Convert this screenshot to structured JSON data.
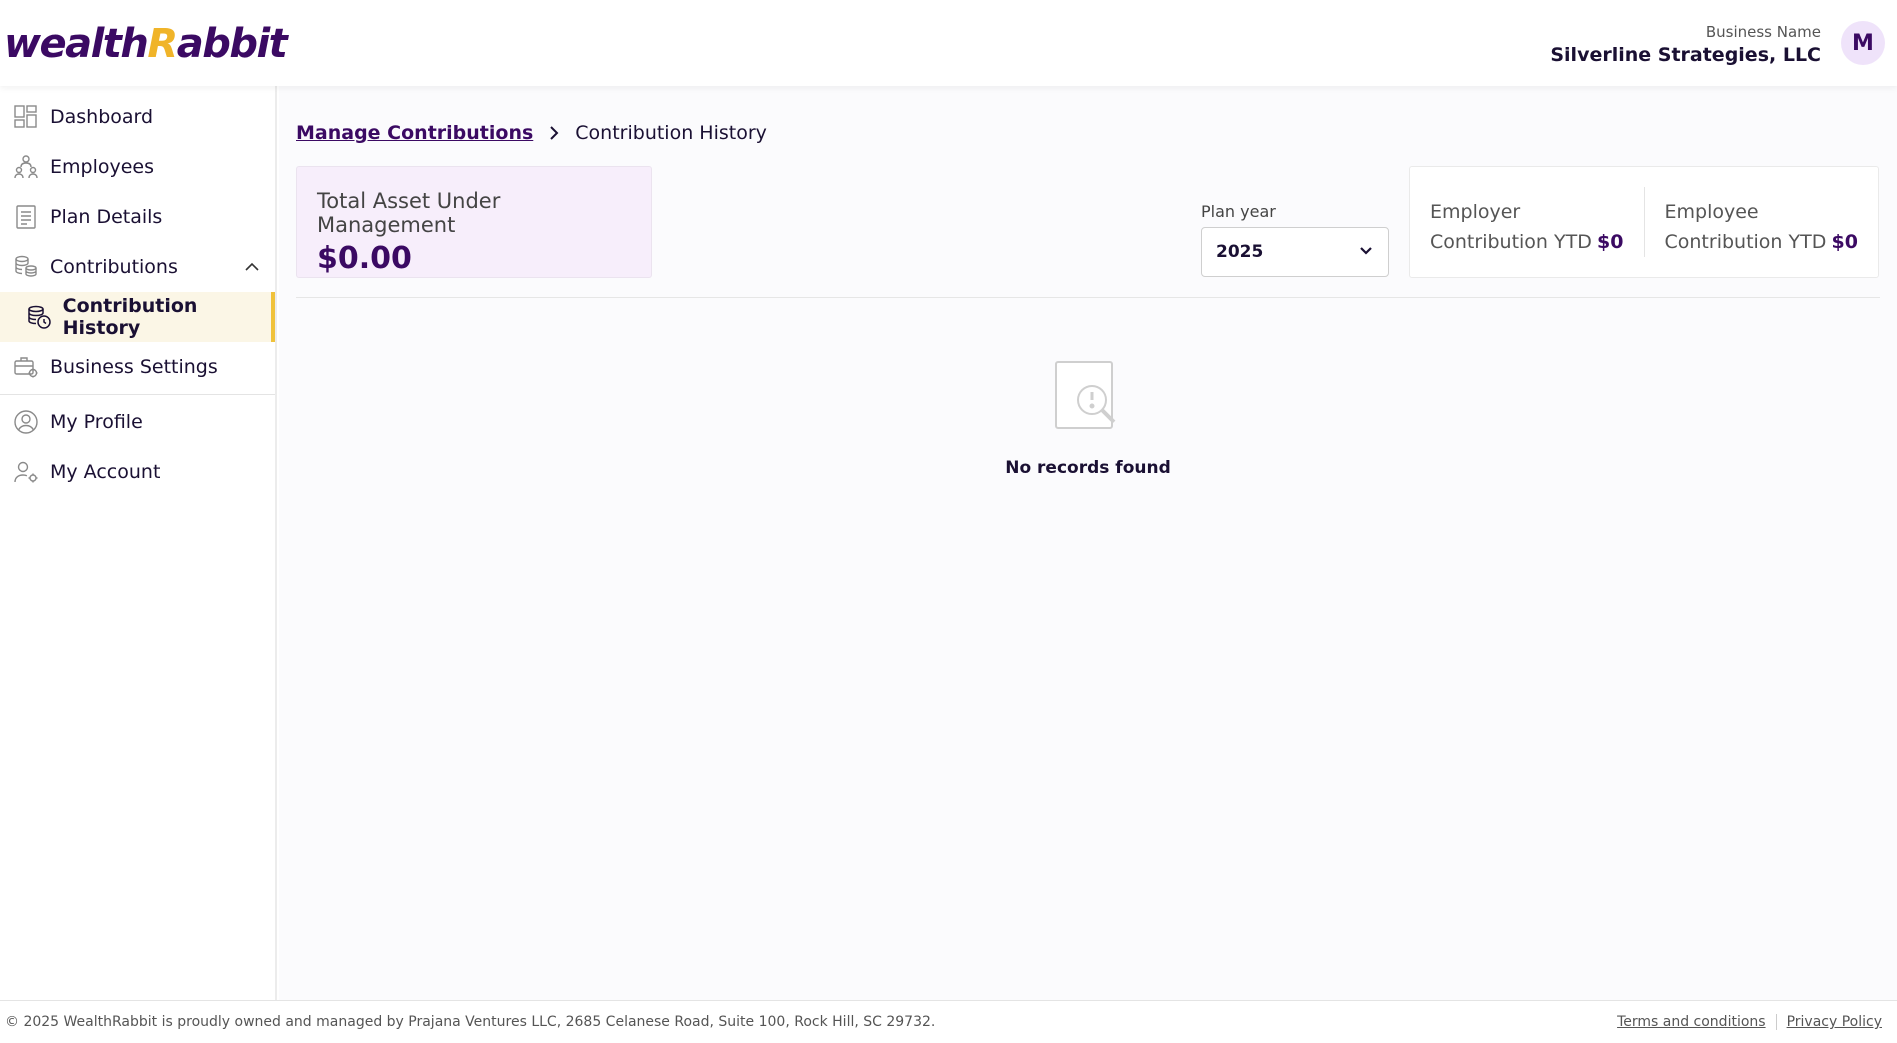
{
  "header": {
    "logo": {
      "part1": "wealth",
      "part2": "R",
      "part3": "abbit"
    },
    "business_label": "Business Name",
    "business_name": "Silverline Strategies, LLC",
    "avatar_initial": "M"
  },
  "sidebar": {
    "items": [
      {
        "label": "Dashboard",
        "icon": "dashboard-icon"
      },
      {
        "label": "Employees",
        "icon": "employees-icon"
      },
      {
        "label": "Plan Details",
        "icon": "plan-details-icon"
      },
      {
        "label": "Contributions",
        "icon": "contributions-icon",
        "expanded": true
      },
      {
        "label": "Contribution History",
        "icon": "contribution-history-icon",
        "active": true
      },
      {
        "label": "Business Settings",
        "icon": "business-settings-icon"
      },
      {
        "label": "My Profile",
        "icon": "profile-icon"
      },
      {
        "label": "My Account",
        "icon": "account-settings-icon"
      }
    ]
  },
  "main": {
    "breadcrumb": {
      "parent": "Manage Contributions",
      "current": "Contribution History"
    },
    "aum": {
      "label": "Total Asset Under Management",
      "value": "$0.00"
    },
    "plan_year": {
      "label": "Plan year",
      "selected": "2025"
    },
    "ytd": {
      "employer_label_line1": "Employer",
      "employer_label_line2": "Contribution YTD",
      "employer_value": "$0",
      "employee_label_line1": "Employee",
      "employee_label_line2": "Contribution YTD",
      "employee_value": "$0"
    },
    "empty_state": {
      "text": "No records found",
      "icon": "no-records-search-icon"
    }
  },
  "footer": {
    "copyright": "© 2025 WealthRabbit is proudly owned and managed by Prajana Ventures LLC, 2685 Celanese Road, Suite 100, Rock Hill, SC 29732.",
    "terms": "Terms and conditions",
    "privacy": "Privacy Policy"
  },
  "colors": {
    "brand_purple": "#3b0a63",
    "brand_gold": "#f0b429",
    "active_bg": "#fbf6e6",
    "active_border": "#f0c23b"
  }
}
